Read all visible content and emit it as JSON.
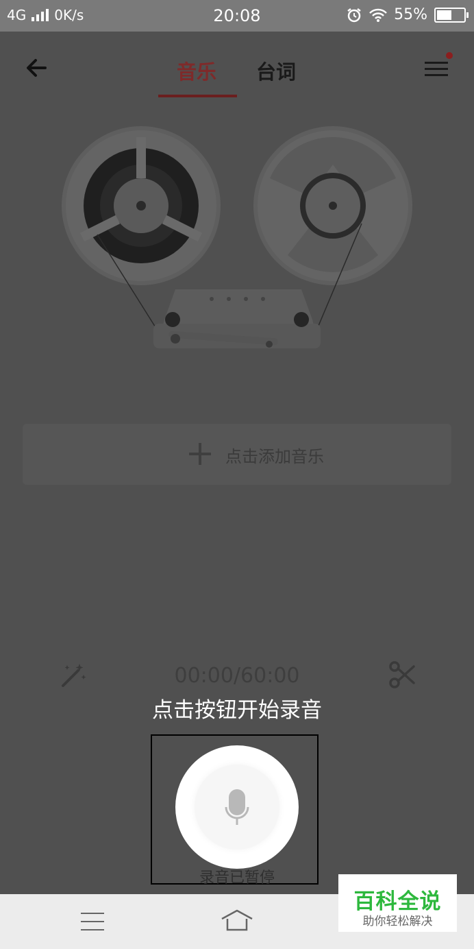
{
  "status_bar": {
    "network": "4G",
    "speed": "0K/s",
    "time": "20:08",
    "battery": "55%",
    "battery_level": 0.55,
    "icons": [
      "signal-icon",
      "alarm-icon",
      "wifi-icon",
      "battery-icon"
    ]
  },
  "header": {
    "tabs": [
      {
        "label": "音乐",
        "active": true
      },
      {
        "label": "台词",
        "active": false
      }
    ],
    "accent_color": "#6b1e1e",
    "has_notification_dot": true
  },
  "main": {
    "add_music_label": "点击添加音乐",
    "timer": "00:00/60:00",
    "hint": "点击按钮开始录音",
    "record_status": "录音已暂停"
  },
  "watermark": {
    "title": "百科全说",
    "subtitle": "助你轻松解决",
    "color": "#2db83d"
  }
}
